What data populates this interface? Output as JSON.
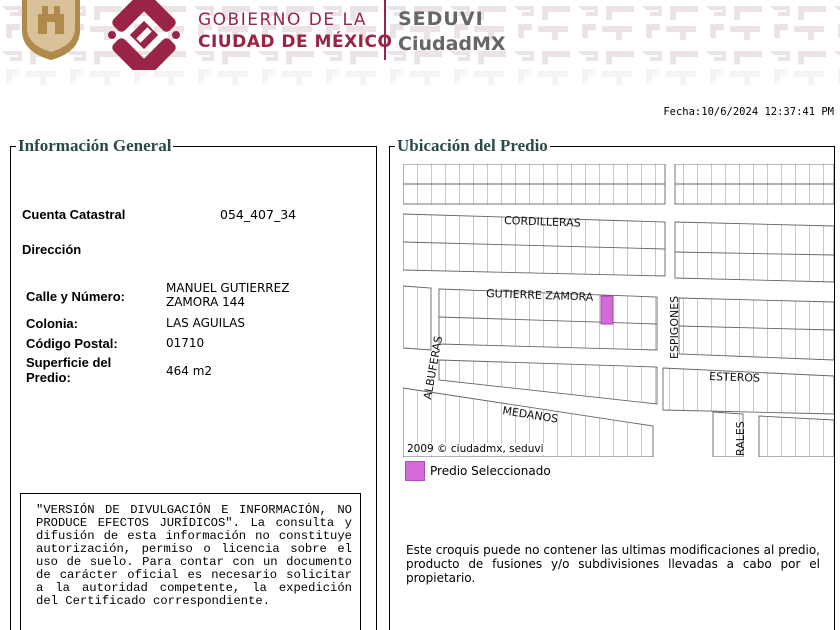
{
  "header": {
    "gobierno_line1": "GOBIERNO DE LA",
    "gobierno_line2": "CIUDAD DE MÉXICO",
    "seduvi_line1": "SEDUVI",
    "seduvi_line2": "CiudadMX",
    "brand_color": "#9a2445"
  },
  "fecha": "Fecha:10/6/2024 12:37:41 PM",
  "info": {
    "title": "Información General",
    "cuenta_label": "Cuenta Catastral",
    "cuenta_value": "054_407_34",
    "direccion_label": "Dirección",
    "calle_label": "Calle y Número:",
    "calle_value_line1": "MANUEL GUTIERREZ",
    "calle_value_line2": "ZAMORA 144",
    "colonia_label": "Colonia:",
    "colonia_value": "LAS AGUILAS",
    "cp_label": "Código Postal:",
    "cp_value": "01710",
    "superficie_label_line1": "Superficie del",
    "superficie_label_line2": "Predio:",
    "superficie_value": "464 m2",
    "disclaimer": "\"VERSIÓN DE DIVULGACIÓN E INFORMACIÓN, NO PRODUCE EFECTOS JURÍDICOS\". La consulta y difusión de esta información no constituye autorización, permiso o licencia sobre el uso de suelo. Para contar con un documento de carácter oficial es necesario solicitar a la autoridad competente, la expedición del Certificado correspondiente."
  },
  "ubicacion": {
    "title": "Ubicación del Predio",
    "streets": {
      "cordilleras": "CORDILLERAS",
      "gutierrez_zamora": "GUTIERRE ZAMORA",
      "espigones": "ESPIGONES",
      "albuferas": "ALBUFERAS",
      "esteros": "ESTEROS",
      "medanos": "MEDANOS",
      "rales": "RALES"
    },
    "credit": "2009 © ciudadmx, seduvi",
    "legend_label": "Predio Seleccionado",
    "legend_color": "#d36bd8",
    "note": "Este croquis puede no contener las ultimas modificaciones al predio, producto de fusiones y/o subdivisiones llevadas a cabo por el propietario."
  }
}
